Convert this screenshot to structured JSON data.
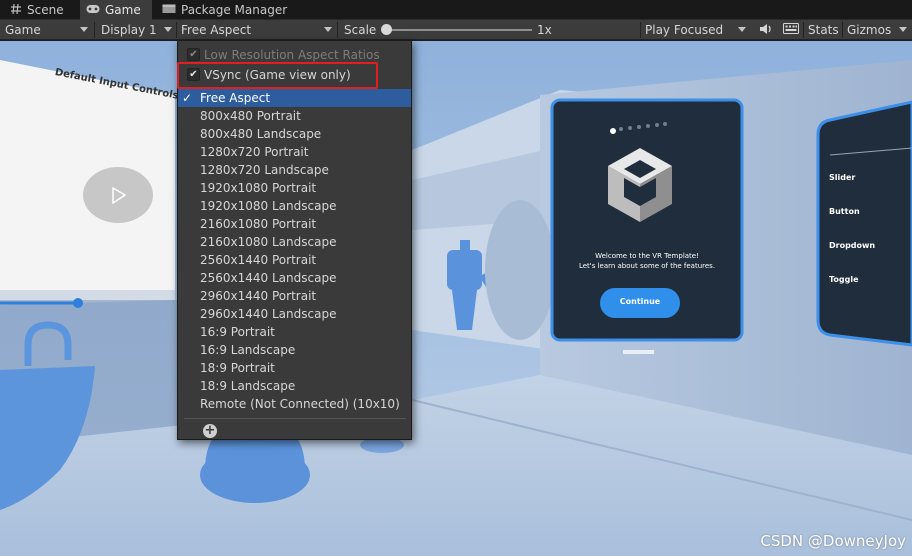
{
  "tabs": [
    {
      "label": "Scene",
      "icon": "hash-icon"
    },
    {
      "label": "Game",
      "icon": "gamepad-icon"
    },
    {
      "label": "Package Manager",
      "icon": "package-icon"
    }
  ],
  "toolbar": {
    "view_mode": "Game",
    "display": "Display 1",
    "aspect": "Free Aspect",
    "scale_label": "Scale",
    "scale_value": "1x",
    "play_mode": "Play Focused",
    "stats": "Stats",
    "gizmos": "Gizmos",
    "mute_icon": "speaker-icon",
    "stats_icon": "keyboard-icon"
  },
  "dropdown": {
    "low_res": {
      "label": "Low Resolution Aspect Ratios",
      "checked": true,
      "enabled": false
    },
    "vsync": {
      "label": "VSync (Game view only)",
      "checked": true,
      "enabled": true
    },
    "items": [
      "Free Aspect",
      "800x480 Portrait",
      "800x480 Landscape",
      "1280x720 Portrait",
      "1280x720 Landscape",
      "1920x1080 Portrait",
      "1920x1080 Landscape",
      "2160x1080 Portrait",
      "2160x1080 Landscape",
      "2560x1440 Portrait",
      "2560x1440 Landscape",
      "2960x1440 Portrait",
      "2960x1440 Landscape",
      "16:9 Portrait",
      "16:9 Landscape",
      "18:9 Portrait",
      "18:9 Landscape",
      "Remote (Not Connected) (10x10)"
    ],
    "selected_index": 0,
    "add_icon": "plus-icon"
  },
  "scene": {
    "left_panel_title": "Default Input Controls",
    "welcome_line1": "Welcome to the VR Template!",
    "welcome_line2": "Let's learn about some of the features.",
    "continue_label": "Continue",
    "menu_items": [
      "Slider",
      "Button",
      "Dropdown",
      "Toggle"
    ]
  },
  "colors": {
    "selection": "#2d5d9e",
    "highlight_border": "#e02020",
    "continue_button": "#2f8fea",
    "panel_border": "#3d8fe8"
  },
  "watermark": "CSDN @DowneyJoy"
}
